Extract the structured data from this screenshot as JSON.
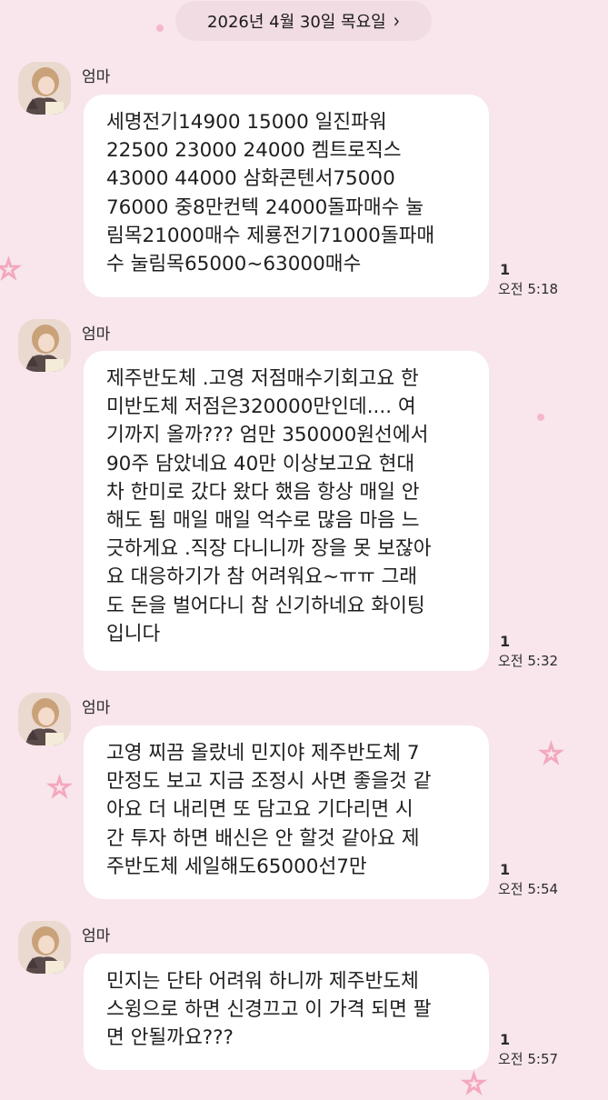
{
  "date_header": {
    "label": "2026년 4월 30일 목요일",
    "chevron": "›"
  },
  "messages": [
    {
      "sender": "엄마",
      "text": "세명전기14900 15000  일진파워\n22500 23000 24000 켐트로직스\n43000 44000  삼화콘텐서75000\n76000 중8만컨텍 24000돌파매수 눌\n림목21000매수 제룡전기71000돌파매\n수 눌림목65000~63000매수",
      "unread": "1",
      "time": "오전 5:18"
    },
    {
      "sender": "엄마",
      "text": "제주반도체 .고영 저점매수기회고요 한\n미반도체 저점은320000만인데.... 여\n기까지 올까??? 엄만 350000원선에서\n90주 담았네요 40만 이상보고요  현대\n차  한미로 갔다 왔다 했음 항상 매일 안\n해도 됨 매일 매일 억수로 많음 마음 느\n긋하게요 .직장 다니니까 장을 못 보잖아\n요  대응하기가 참 어려워요~ㅠㅠ 그래\n도 돈을 벌어다니 참 신기하네요 화이팅\n입니다",
      "unread": "1",
      "time": "오전 5:32"
    },
    {
      "sender": "엄마",
      "text": "고영 찌끔 올랐네  민지야 제주반도체 7\n만정도 보고 지금 조정시 사면 좋을것 같\n아요 더 내리면 또 담고요  기다리면 시\n간 투자 하면  배신은 안 할것 같아요 제\n주반도체 세일해도65000선7만",
      "unread": "1",
      "time": "오전 5:54"
    },
    {
      "sender": "엄마",
      "text": "민지는 단타 어려워 하니까 제주반도체\n스윙으로 하면 신경끄고 이 가격 되면 팔\n면 안될까요???",
      "unread": "1",
      "time": "오전 5:57"
    }
  ],
  "colors": {
    "background": "#f8e6ec",
    "bubble": "#ffffff",
    "date_pill": "#f1dce3",
    "decoration": "#f3a8bd"
  },
  "icons": {
    "star": "star-icon",
    "dot": "dot-icon",
    "chevron": "chevron-right-icon"
  }
}
